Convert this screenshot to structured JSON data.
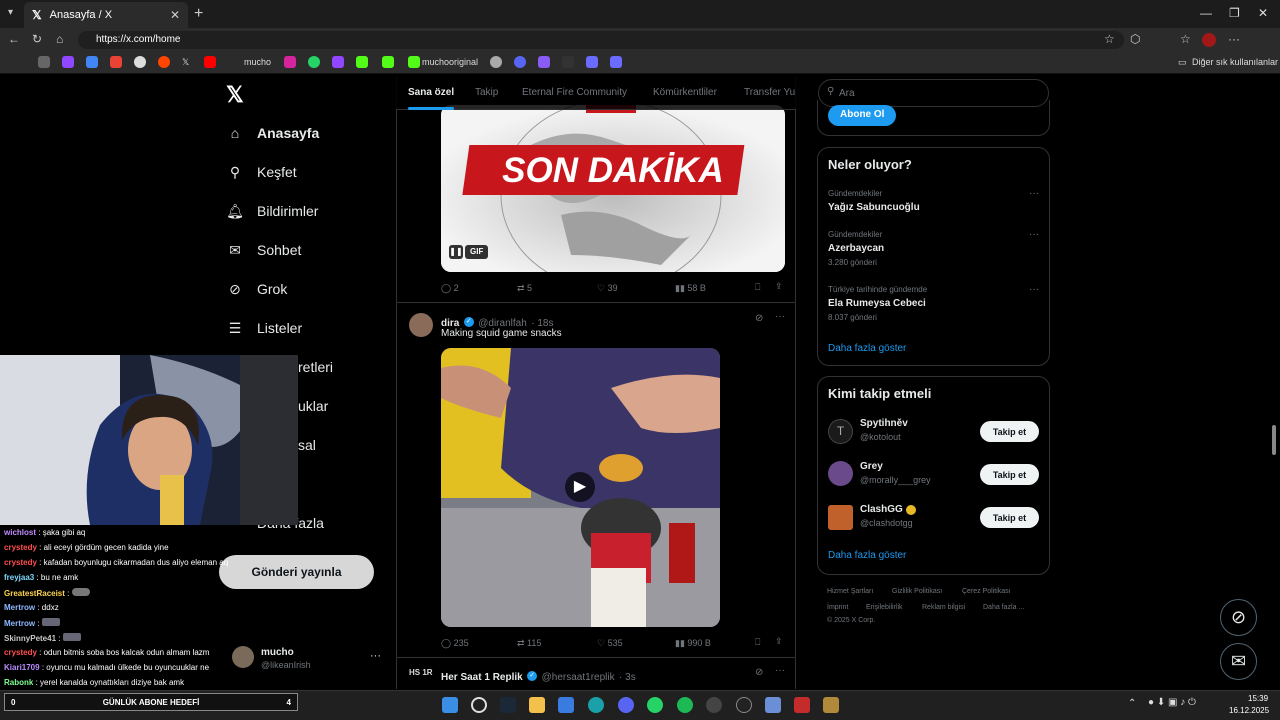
{
  "browser": {
    "tab_title": "Anasayfa / X",
    "url": "https://x.com/home",
    "bookmarks": [
      "mucho",
      "muchooriginal"
    ],
    "other_bookmarks": "Diğer sık kullanılanlar"
  },
  "nav": {
    "items": [
      "Anasayfa",
      "Keşfet",
      "Bildirimler",
      "Sohbet",
      "Grok",
      "Listeler",
      "retleri",
      "uklar",
      "sal",
      "Daha fazla"
    ],
    "post_button": "Gönderi yayınla",
    "account_name": "mucho",
    "account_handle": "@likeanIrish"
  },
  "feed_tabs": [
    "Sana özel",
    "Takip",
    "Eternal Fire Community",
    "Kömürkentliler",
    "Transfer Yu"
  ],
  "tweet1": {
    "banner": "SON DAKİKA",
    "gif": "GIF",
    "replies": "2",
    "retweets": "5",
    "likes": "39",
    "views": "58 B"
  },
  "tweet2": {
    "name": "dira",
    "handle": "@diranlfah",
    "time": "· 18s",
    "text": "Making squid game snacks",
    "replies": "235",
    "retweets": "115",
    "likes": "535",
    "views": "990 B"
  },
  "tweet3": {
    "name": "Her Saat 1 Replik",
    "handle": "@hersaat1replik",
    "time": "· 3s",
    "avatar_text": "HS 1R"
  },
  "search": {
    "placeholder": "Ara"
  },
  "subscribe": {
    "label": "Abone Ol"
  },
  "trends": {
    "title": "Neler oluyor?",
    "items": [
      {
        "category": "Gündemdekiler",
        "title": "Yağız Sabuncuoğlu",
        "count": ""
      },
      {
        "category": "Gündemdekiler",
        "title": "Azerbaycan",
        "count": "3.280 gönderi"
      },
      {
        "category": "Türkiye tarihinde gündemde",
        "title": "Ela Rumeysa Cebeci",
        "count": "8.037 gönderi"
      }
    ],
    "show_more": "Daha fazla göster"
  },
  "who_to_follow": {
    "title": "Kimi takip etmeli",
    "items": [
      {
        "name": "Spytihněv",
        "handle": "@kotolout"
      },
      {
        "name": "Grey",
        "handle": "@morally___grey"
      },
      {
        "name": "ClashGG",
        "handle": "@clashdotgg"
      }
    ],
    "follow_label": "Takip et",
    "show_more": "Daha fazla göster"
  },
  "footer": [
    "Hizmet Şartları",
    "Gizlilik Politikası",
    "Çerez Politikası",
    "İmprint",
    "Erişilebilirlik",
    "Reklam bilgisi",
    "Daha fazla ...",
    "© 2025 X Corp."
  ],
  "chat": [
    {
      "user": "wichlost",
      "color": "#c28cff",
      "msg": "şaka gibi aq"
    },
    {
      "user": "crystedy",
      "color": "#ff4f4f",
      "msg": "ali eceyi gördüm gecen kadida yine"
    },
    {
      "user": "crystedy",
      "color": "#ff4f4f",
      "msg": "kafadan boyunlugu cikarmadan dus aliyo eleman aq"
    },
    {
      "user": "freyjaa3",
      "color": "#7fd9ff",
      "msg": "bu ne amk"
    },
    {
      "user": "GreatestRaceist",
      "color": "#ffd54f",
      "msg": ""
    },
    {
      "user": "Mertrow",
      "color": "#8fb8ff",
      "msg": "ddxz"
    },
    {
      "user": "Mertrow",
      "color": "#8fb8ff",
      "msg": ""
    },
    {
      "user": "SkinnyPete41",
      "color": "#c8c8c8",
      "msg": ""
    },
    {
      "user": "crystedy",
      "color": "#ff4f4f",
      "msg": "odun bitmis soba bos kalcak odun almam lazm"
    },
    {
      "user": "Kiari1709",
      "color": "#b98cff",
      "msg": "oyuncu mu kalmadı ülkede bu oyuncuuklar ne"
    },
    {
      "user": "Rabonk",
      "color": "#7fff8f",
      "msg": "yerel kanalda oynattıkları diziye bak amk"
    }
  ],
  "stream": {
    "goal_label": "GÜNLÜK ABONE HEDEFİ",
    "goal_left": "0",
    "goal_right": "4"
  },
  "system": {
    "time": "15:39",
    "date": "16.12.2025"
  }
}
